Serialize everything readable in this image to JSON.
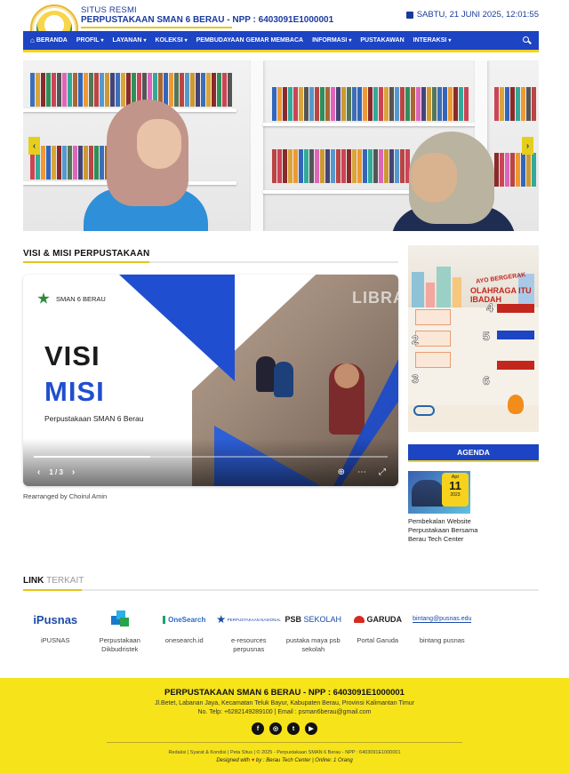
{
  "header": {
    "site_small": "SITUS RESMI",
    "site_title": "PERPUSTAKAAN SMAN 6 BERAU - NPP : 6403091E1000001",
    "date": "SABTU, 21 JUNI 2025, 12:01:55"
  },
  "nav": {
    "items": [
      {
        "label": "BERANDA",
        "icon": "home-icon"
      },
      {
        "label": "PROFIL"
      },
      {
        "label": "LAYANAN"
      },
      {
        "label": "KOLEKSI"
      },
      {
        "label": "PEMBUDAYAAN GEMAR MEMBACA"
      },
      {
        "label": "INFORMASI"
      },
      {
        "label": "PUSTAKAWAN"
      },
      {
        "label": "INTERAKSI"
      }
    ],
    "search_icon": "search-icon"
  },
  "slider": {
    "prev": "‹",
    "next": "›"
  },
  "visi_misi": {
    "title": "VISI & MISI PERPUSTAKAAN",
    "card": {
      "badge": "SMAN 6 BERAU",
      "visi": "VISI",
      "misi": "MISI",
      "subtitle": "Perpustakaan SMAN 6 Berau",
      "library_text": "LIBRA",
      "page": "1 / 3"
    },
    "caption": "Rearranged by Choirul Amin"
  },
  "poster": {
    "line1": "AYO BERGERAK",
    "line2": "OLAHRAGA ITU IBADAH"
  },
  "agenda": {
    "button": "AGENDA",
    "month": "Apr",
    "day": "11",
    "year": "2023",
    "title": "Pembekalan Website Perpustakaan Bersama Berau Tech Center"
  },
  "links": {
    "title_bold": "LINK",
    "title_light": "TERKAIT",
    "items": [
      {
        "logo": "iPusnas",
        "label": "iPUSNAS"
      },
      {
        "logo": "",
        "label": "Perpustakaan Dikbudristek"
      },
      {
        "logo": "OneSearch",
        "label": "onesearch.id"
      },
      {
        "logo": "PERPUSTAKAAN NASIONAL",
        "label": "e-resources perpusnas"
      },
      {
        "logo_a": "PSB",
        "logo_b": "SEKOLAH",
        "label": "pustaka maya psb sekolah"
      },
      {
        "logo": "GARUDA",
        "label": "Portal Garuda"
      },
      {
        "logo": "bintang@pusnas.edu",
        "label": "bintang pusnas"
      }
    ]
  },
  "footer": {
    "title": "PERPUSTAKAAN SMAN 6 BERAU - NPP : 6403091E1000001",
    "address": "Jl.Betet, Labanan Jaya, Kecamatan Teluk Bayur, Kabupaten Berau, Provinsi Kalimantan Timur",
    "contact": "No. Telp: +6282149289100 | Email : psman6berau@gmail.com",
    "social": [
      "facebook-icon",
      "instagram-icon",
      "twitter-icon",
      "youtube-icon"
    ],
    "links": "Redaksi | Syarat & Kondisi | Peta Situs | © 2025 - Perpustakaan SMAN 6 Berau - NPP : 6403091E1000001",
    "design_a": "Designed with",
    "design_b": "by : Berau Tech Center | Online: 1 Orang"
  },
  "colors": {
    "primary": "#1d44c3",
    "accent": "#f2d21a",
    "footer_bg": "#f6e31a"
  }
}
